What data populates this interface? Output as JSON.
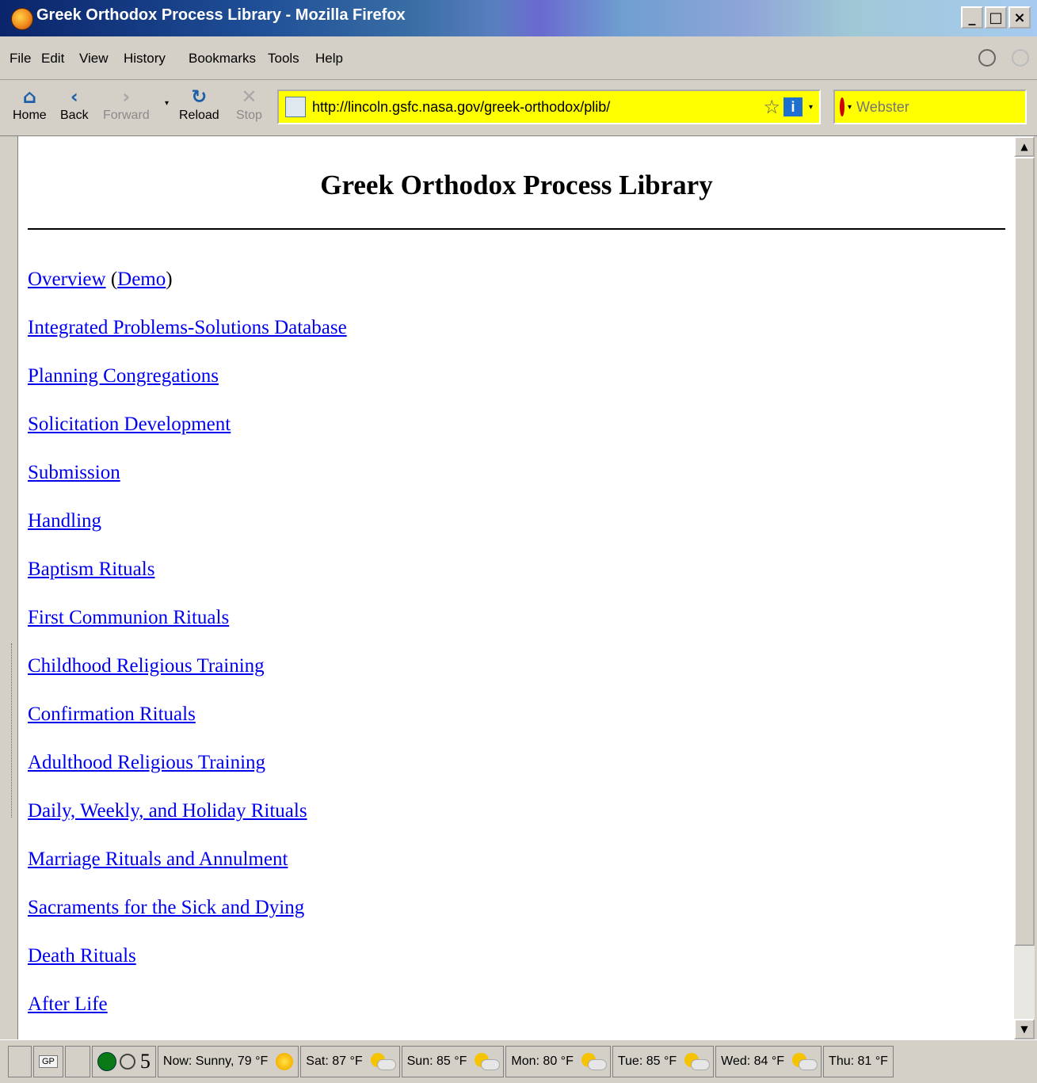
{
  "window": {
    "title": "Greek Orthodox Process Library - Mozilla Firefox"
  },
  "menu": [
    "File",
    "Edit",
    "View",
    "History",
    "Bookmarks",
    "Tools",
    "Help"
  ],
  "nav": {
    "home": "Home",
    "back": "Back",
    "forward": "Forward",
    "reload": "Reload",
    "stop": "Stop",
    "url": "http://lincoln.gsfc.nasa.gov/greek-orthodox/plib/",
    "search_placeholder": "Webster"
  },
  "page": {
    "title": "Greek Orthodox Process Library",
    "overview": "Overview",
    "demo": "Demo",
    "paren_open": "(",
    "paren_close": ")",
    "links": [
      "Integrated Problems-Solutions Database",
      "Planning Congregations",
      "Solicitation Development",
      "Submission",
      "Handling",
      "Baptism Rituals",
      "First Communion Rituals",
      "Childhood Religious Training",
      "Confirmation Rituals",
      "Adulthood Religious Training",
      "Daily, Weekly, and Holiday Rituals",
      "Marriage Rituals and Annulment",
      "Sacraments for the Sick and Dying",
      "Death Rituals",
      "After Life"
    ]
  },
  "status": {
    "gp": "GP",
    "count": "5",
    "now": "Now: Sunny, 79 °F",
    "forecast": [
      "Sat: 87 °F",
      "Sun: 85 °F",
      "Mon: 80 °F",
      "Tue: 85 °F",
      "Wed: 84 °F",
      "Thu: 81 °F"
    ]
  }
}
